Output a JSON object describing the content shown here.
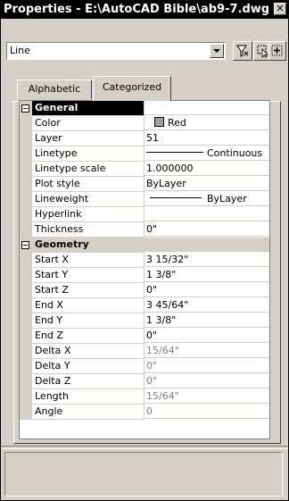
{
  "window": {
    "title": "Properties - E:\\AutoCAD Bible\\ab9-7.dwg",
    "close_glyph": "✕"
  },
  "selector": {
    "value": "Line"
  },
  "toolbar": {
    "icons": [
      "quick-select-filter-icon",
      "select-objects-icon",
      "pickadd-toggle-icon"
    ]
  },
  "tabs": [
    {
      "label": "Alphabetic",
      "active": false
    },
    {
      "label": "Categorized",
      "active": true
    }
  ],
  "categories": [
    {
      "name": "General",
      "expander": "−",
      "properties": [
        {
          "name": "Color",
          "value": "Red",
          "swatch": "#a0a0a0",
          "enabled": true
        },
        {
          "name": "Layer",
          "value": "51",
          "enabled": true
        },
        {
          "name": "Linetype",
          "value": "Continuous",
          "enabled": true
        },
        {
          "name": "Linetype scale",
          "value": "1.000000",
          "enabled": true
        },
        {
          "name": "Plot style",
          "value": "ByLayer",
          "enabled": true
        },
        {
          "name": "Lineweight",
          "value": "ByLayer",
          "enabled": true
        },
        {
          "name": "Hyperlink",
          "value": "",
          "enabled": true
        },
        {
          "name": "Thickness",
          "value": "0\"",
          "enabled": true
        }
      ]
    },
    {
      "name": "Geometry",
      "expander": "−",
      "properties": [
        {
          "name": "Start X",
          "value": "3 15/32\"",
          "enabled": true
        },
        {
          "name": "Start Y",
          "value": "1 3/8\"",
          "enabled": true
        },
        {
          "name": "Start Z",
          "value": "0\"",
          "enabled": true
        },
        {
          "name": "End X",
          "value": "3 45/64\"",
          "enabled": true
        },
        {
          "name": "End Y",
          "value": "1 3/8\"",
          "enabled": true
        },
        {
          "name": "End Z",
          "value": "0\"",
          "enabled": true
        },
        {
          "name": "Delta X",
          "value": "15/64\"",
          "enabled": false
        },
        {
          "name": "Delta Y",
          "value": "0\"",
          "enabled": false
        },
        {
          "name": "Delta Z",
          "value": "0\"",
          "enabled": false
        },
        {
          "name": "Length",
          "value": "15/64\"",
          "enabled": false
        },
        {
          "name": "Angle",
          "value": "0",
          "enabled": false
        }
      ]
    }
  ]
}
